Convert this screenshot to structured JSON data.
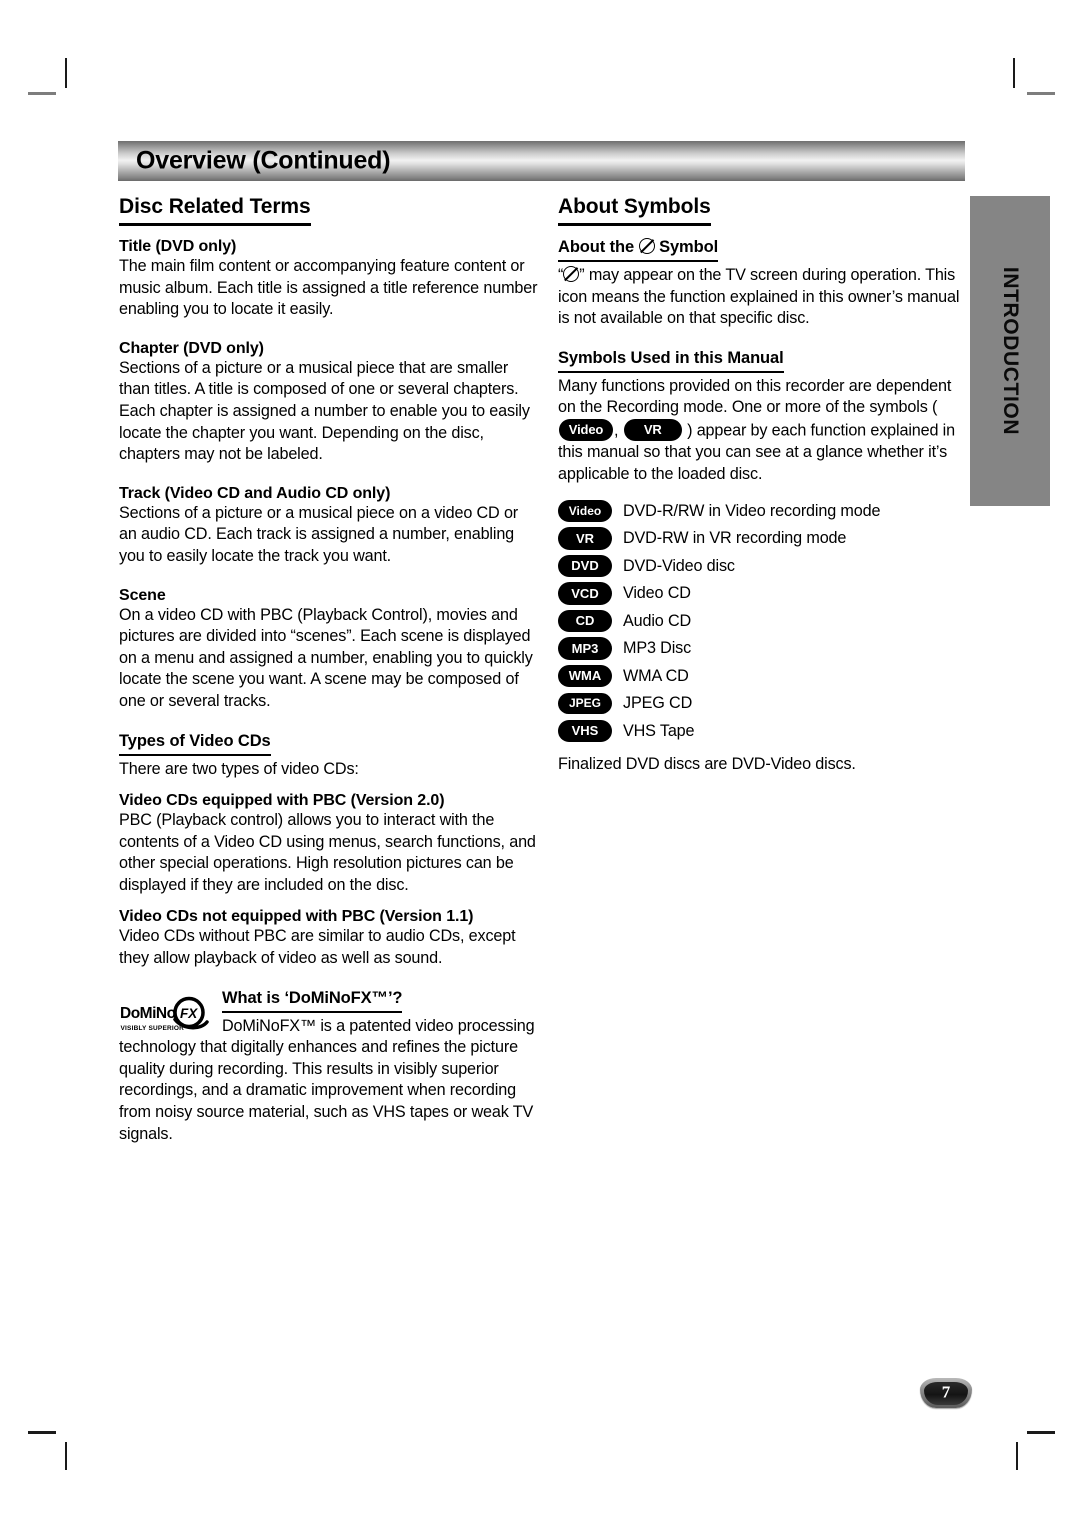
{
  "page": {
    "title": "Overview (Continued)",
    "side_tab_label": "INTRODUCTION",
    "page_number": "7"
  },
  "left_column": {
    "section_title": "Disc Related Terms",
    "entries": [
      {
        "heading": "Title (DVD only)",
        "body": "The main film content or accompanying feature content or music album. Each title is assigned a title reference number enabling you to locate it easily."
      },
      {
        "heading": "Chapter (DVD only)",
        "body": "Sections of a picture or a musical piece that are smaller than titles. A title is composed of one or several chapters. Each chapter is assigned a number to enable you to easily locate the chapter you want. Depending on the disc, chapters may not be labeled."
      },
      {
        "heading": "Track (Video CD and Audio CD only)",
        "body": "Sections of a picture or a musical piece on a video CD or an audio CD. Each track is assigned a number, enabling you to easily locate the track you want."
      },
      {
        "heading": "Scene",
        "body": "On a video CD with PBC (Playback Control), movies and pictures are divided into “scenes”. Each scene is displayed on a menu and assigned a number, enabling you to quickly locate the scene you want. A scene may be composed of one or several tracks."
      }
    ],
    "types_section": {
      "title": "Types of Video CDs",
      "intro": "There are two types of video CDs:",
      "entries": [
        {
          "heading": "Video CDs equipped with PBC (Version 2.0)",
          "body": "PBC (Playback control) allows you to interact with the contents of a Video CD using menus, search functions, and other special operations. High resolution pictures can be displayed if they are included on the disc."
        },
        {
          "heading": "Video CDs not equipped with PBC (Version 1.1)",
          "body": "Video CDs without PBC are similar to audio CDs, except they allow playback of video as well as sound."
        }
      ]
    },
    "dominofx": {
      "heading": "What is ‘DoMiNoFX™’?",
      "logo_text": "DoMiNo",
      "logo_mark": "FX",
      "logo_tagline": "VISIBLY SUPERIOR",
      "body": "DoMiNoFX™ is a patented video processing technology that digitally enhances and refines the picture quality during recording. This results in visibly superior recordings, and a dramatic improvement when recording from noisy source material, such as VHS tapes or weak TV signals."
    }
  },
  "right_column": {
    "section_title": "About Symbols",
    "about_symbol": {
      "heading_before": "About the",
      "heading_icon": "no-symbol-icon",
      "heading_after": "Symbol",
      "body_part1": "“",
      "body_part2": "” may appear on the TV screen during operation. This icon means the function explained in this owner’s manual is not available on that specific disc."
    },
    "symbols_used": {
      "heading": "Symbols Used in this Manual",
      "body_part1": "Many functions provided on this recorder are dependent on the Recording mode. One or more of the symbols",
      "open_paren": "(",
      "badge1": "Video",
      "comma": ",",
      "badge2": "VR",
      "close_paren": ")",
      "body_part2": "appear by each function explained in this manual so that you can see at a glance whether it’s applicable to the loaded disc."
    },
    "symbol_legend": [
      {
        "badge": "Video",
        "description": "DVD-R/RW in Video recording mode"
      },
      {
        "badge": "VR",
        "description": "DVD-RW in VR recording mode"
      },
      {
        "badge": "DVD",
        "description": "DVD-Video disc"
      },
      {
        "badge": "VCD",
        "description": "Video CD"
      },
      {
        "badge": "CD",
        "description": "Audio CD"
      },
      {
        "badge": "MP3",
        "description": "MP3 Disc"
      },
      {
        "badge": "WMA",
        "description": "WMA CD"
      },
      {
        "badge": "JPEG",
        "description": "JPEG CD"
      },
      {
        "badge": "VHS",
        "description": "VHS Tape"
      }
    ],
    "finalized_note": "Finalized DVD discs are DVD-Video discs."
  },
  "colors": {
    "side_tab_bg": "#858585",
    "badge_bg": "#000000",
    "badge_text": "#ffffff"
  }
}
